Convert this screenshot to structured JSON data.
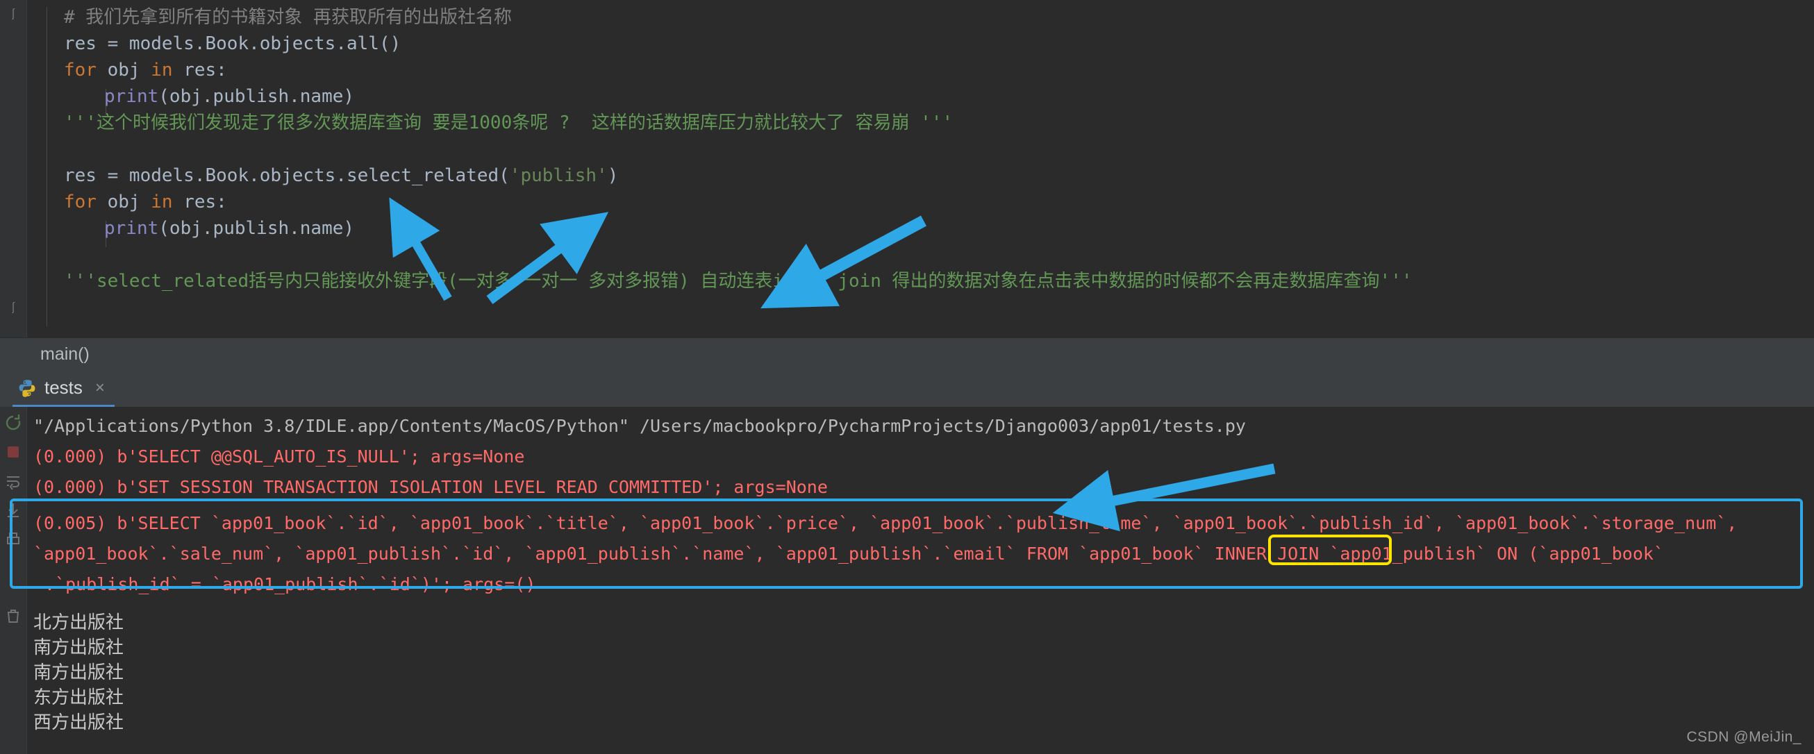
{
  "editor": {
    "lines": [
      {
        "indent": 0,
        "segments": [
          {
            "cls": "tok-comment",
            "text": "# 我们先拿到所有的书籍对象 再获取所有的出版社名称"
          }
        ]
      },
      {
        "indent": 0,
        "segments": [
          {
            "cls": "tok-plain",
            "text": "res = models.Book.objects.all()"
          }
        ]
      },
      {
        "indent": 0,
        "segments": [
          {
            "cls": "tok-kw",
            "text": "for"
          },
          {
            "cls": "tok-plain",
            "text": " obj "
          },
          {
            "cls": "tok-kw",
            "text": "in"
          },
          {
            "cls": "tok-plain",
            "text": " res:"
          }
        ]
      },
      {
        "indent": 1,
        "segments": [
          {
            "cls": "tok-fn",
            "text": "print"
          },
          {
            "cls": "tok-plain",
            "text": "(obj.publish.name)"
          }
        ]
      },
      {
        "indent": 0,
        "segments": [
          {
            "cls": "tok-docstr",
            "text": "'''这个时候我们发现走了很多次数据库查询 要是1000条呢 ?  这样的话数据库压力就比较大了 容易崩 '''"
          }
        ]
      },
      {
        "indent": 0,
        "segments": [
          {
            "cls": "tok-plain",
            "text": ""
          }
        ]
      },
      {
        "indent": 0,
        "segments": [
          {
            "cls": "tok-plain",
            "text": "res = models.Book.objects.select_related("
          },
          {
            "cls": "tok-str",
            "text": "'publish'"
          },
          {
            "cls": "tok-plain",
            "text": ")"
          }
        ]
      },
      {
        "indent": 0,
        "segments": [
          {
            "cls": "tok-kw",
            "text": "for"
          },
          {
            "cls": "tok-plain",
            "text": " obj "
          },
          {
            "cls": "tok-kw",
            "text": "in"
          },
          {
            "cls": "tok-plain",
            "text": " res:"
          }
        ]
      },
      {
        "indent": 1,
        "segments": [
          {
            "cls": "tok-fn",
            "text": "print"
          },
          {
            "cls": "tok-plain",
            "text": "(obj.publish.name)"
          }
        ]
      },
      {
        "indent": 0,
        "segments": [
          {
            "cls": "tok-plain",
            "text": ""
          }
        ]
      },
      {
        "indent": 0,
        "segments": [
          {
            "cls": "tok-docstr",
            "text": "'''select_related括号内只能接收外键字段(一对多 一对一 多对多报错) 自动连表inner join 得出的数据对象在点击表中数据的时候都不会再走数据库查询'''"
          }
        ]
      }
    ]
  },
  "breadcrumb": {
    "text": "main()"
  },
  "run_tab": {
    "label": "tests",
    "close_label": "×",
    "icon": "python-icon"
  },
  "console": {
    "lines": [
      {
        "cls": "c-path",
        "text": "\"/Applications/Python 3.8/IDLE.app/Contents/MacOS/Python\" /Users/macbookpro/PycharmProjects/Django003/app01/tests.py"
      },
      {
        "cls": "c-sql",
        "text": "(0.000) b'SELECT @@SQL_AUTO_IS_NULL'; args=None"
      },
      {
        "cls": "c-sql",
        "text": "(0.000) b'SET SESSION TRANSACTION ISOLATION LEVEL READ COMMITTED'; args=None"
      }
    ],
    "sql_block": {
      "line1": "(0.005) b'SELECT `app01_book`.`id`, `app01_book`.`title`, `app01_book`.`price`, `app01_book`.`publish_time`, `app01_book`.`publish_id`, `app01_book`.`storage_num`,",
      "line2_pre": "`app01_book`.`sale_num`, `app01_publish`.`id`, `app01_publish`.`name`, `app01_publish`.`email` FROM `app01_book` ",
      "line2_highlight": "INNER JOIN",
      "line2_post": " `app01_publish` ON (`app01_book`",
      "line3": ".`publish_id` = `app01_publish`.`id`)'; args=()"
    },
    "output": [
      "北方出版社",
      "南方出版社",
      "南方出版社",
      "东方出版社",
      "西方出版社"
    ]
  },
  "annotations": {
    "blue_box_label": "sql-statement-highlight",
    "yellow_box_label": "inner-join-highlight",
    "arrow_color": "#2fa8e8",
    "box_blue_color": "#2fa8e8",
    "box_yellow_color": "#ffe400"
  },
  "watermark": {
    "text": "CSDN @MeiJin_"
  }
}
